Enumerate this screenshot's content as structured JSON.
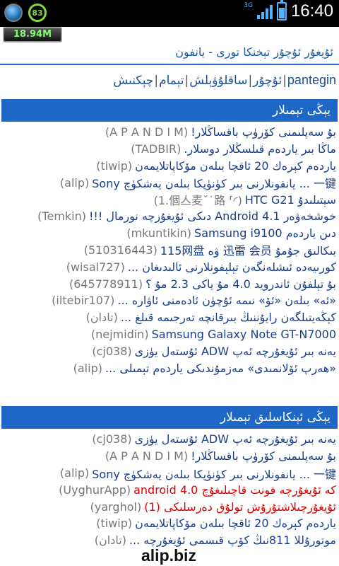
{
  "status_bar": {
    "battery_percent": "83",
    "network": "3G",
    "time": "16:40",
    "colors": {
      "accent": "#4fb3ff",
      "battery_ring": "#7fdc3f"
    }
  },
  "memory_widget": {
    "value": "18.94M"
  },
  "site": {
    "title": "ئۇيغۇر ئۇچۇر تېخنكا تورى - يانفون"
  },
  "nav": {
    "items": [
      {
        "label": "pantegin"
      },
      {
        "label": "ئۇچۇر"
      },
      {
        "label": "ساقلۇۋېلش"
      },
      {
        "label": "تېمام"
      },
      {
        "label": "چېكنىش"
      }
    ]
  },
  "section_new_topics": {
    "heading": "يېڭى تېمىلار",
    "rows": [
      {
        "title": "بۇ سەپلىمنى كۆرۈپ باقساڭلار!",
        "author": "A P A N D I M",
        "red": false
      },
      {
        "title": "ماڭا بىر ياردەم قىلسڭلار دوسلار.",
        "author": "TADBIR",
        "red": false
      },
      {
        "title": "ياردەم كېرەك 20 ئاقچا بىلەن مۆكاپاتلايمەن",
        "author": "tiwip",
        "red": false
      },
      {
        "title": "Sony يانفونلارنى بىر كۈنۈپكا بىلەن يەشكۈچ ... 一键",
        "author": "alip",
        "red": false
      },
      {
        "title": "HTC G21 سېتىلىدۇ",
        "author": "1.個亼麦ˇ˙路 ⸢◜",
        "red": false
      },
      {
        "title": "خوشخەۋەر Android 4.1 دىكى ئۇيغۇرچە نورمال !!!",
        "author": "Temkin",
        "red": false
      },
      {
        "title": "Samsung i9100 دىن ياردەم",
        "author": "mkuntikin",
        "red": false
      },
      {
        "title": "115网盘 ۋە 迅雷 会员 بىكالىق جۇمۇ",
        "author": "510316443",
        "red": false
      },
      {
        "title": "كورىيەدە ئىشلەنگەن تېلېفونلارنى ئالىدىغان ...",
        "author": "wisal727",
        "red": false
      },
      {
        "title": "بۇ تېلفۇن ئاندرويد 4.0 مۇ ياكى 2.3 مۇ ؟",
        "author": "645778911",
        "red": false
      },
      {
        "title": "«ئە» بىلەن «ئۆ» نىمە ئۇچۈن ئادەمنى ئاۋارە ...",
        "author": "iltebir107",
        "red": false
      },
      {
        "title": "كېڭەيتىلگەن رايۇننىڭ بىرقانچە تەرجىمە قىلغ ...",
        "author": "تادان",
        "red": false
      },
      {
        "title": "Samsung Galaxy Note GT-N7000",
        "author": "nejmidin",
        "red": false
      },
      {
        "title": "يەنە بىر ئۇيغۇرچە ئەپ ADW ئۇستەل يۈزى",
        "author": "cj038",
        "red": false
      },
      {
        "title": "«ھەرپ ئۆلانمىدى» مەزمۇندىكى ياردەم تېمىلى ...",
        "author": "alip",
        "red": false
      }
    ]
  },
  "section_featured": {
    "heading": "يېڭى ئېنكاسلىق تېمىلار",
    "rows": [
      {
        "title": "يەنە بىر ئۇيغۇرچە ئەپ ADW ئۇستەل يۈزى",
        "author": "cj038",
        "red": false
      },
      {
        "title": "بۇ سەپلىمنى كۆرۈپ باقساڭلار!",
        "author": "A P A N D I M",
        "red": false
      },
      {
        "title": "Sony يانفونلارنى بىر كۈنۈپكا بىلەن يەشكۈچ ... 一键",
        "author": "alip",
        "red": false
      },
      {
        "title": "android 4.0 كە ئۇيغۇرچە فونت قاچىلىغۇچ",
        "author": "UyghurApp",
        "red": true
      },
      {
        "title": "ئۇيغۇرچىلاشتۇرۇش تولۇق دەرسلىكى (1)",
        "author": "yarghol",
        "red": true
      },
      {
        "title": "ياردەم كېرەك 20 ئاقچا بىلەن مۆكاپاتلايمەن",
        "author": "tiwip",
        "red": false
      },
      {
        "title": "موتورۇللا 811نىڭ كۆپ قىسمى ئۇيغۇرچە ...",
        "author": "تادان",
        "red": false
      }
    ]
  },
  "watermark": {
    "text": "alip.biz"
  }
}
